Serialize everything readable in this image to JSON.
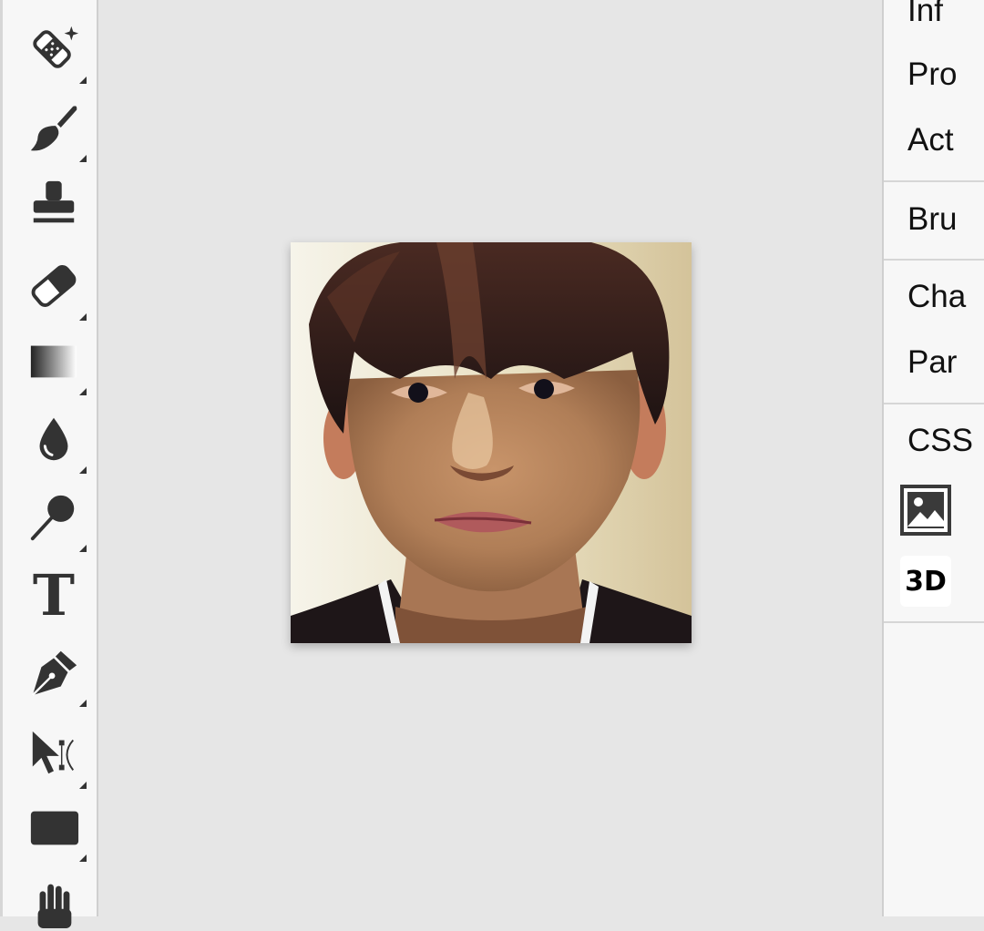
{
  "toolbar": {
    "tools": [
      {
        "name": "healing-brush-icon"
      },
      {
        "name": "brush-icon"
      },
      {
        "name": "clone-stamp-icon"
      },
      {
        "name": "eraser-icon"
      },
      {
        "name": "gradient-icon"
      },
      {
        "name": "blur-drop-icon"
      },
      {
        "name": "dodge-icon"
      },
      {
        "name": "type-icon",
        "glyph": "T"
      },
      {
        "name": "pen-icon"
      },
      {
        "name": "path-select-icon"
      },
      {
        "name": "rectangle-icon"
      },
      {
        "name": "hand-icon"
      }
    ]
  },
  "right_panel": {
    "items": [
      {
        "label": "Inf"
      },
      {
        "label": "Pro"
      },
      {
        "label": "Act"
      },
      {
        "label": "Bru"
      },
      {
        "label": "Cha"
      },
      {
        "label": "Par"
      },
      {
        "label": "CSS"
      }
    ],
    "image_icon": "image-icon",
    "three_d_label": "3D"
  },
  "colors": {
    "toolbar_bg": "#f7f7f7",
    "canvas_bg": "#e6e6e6",
    "icon": "#333333"
  }
}
